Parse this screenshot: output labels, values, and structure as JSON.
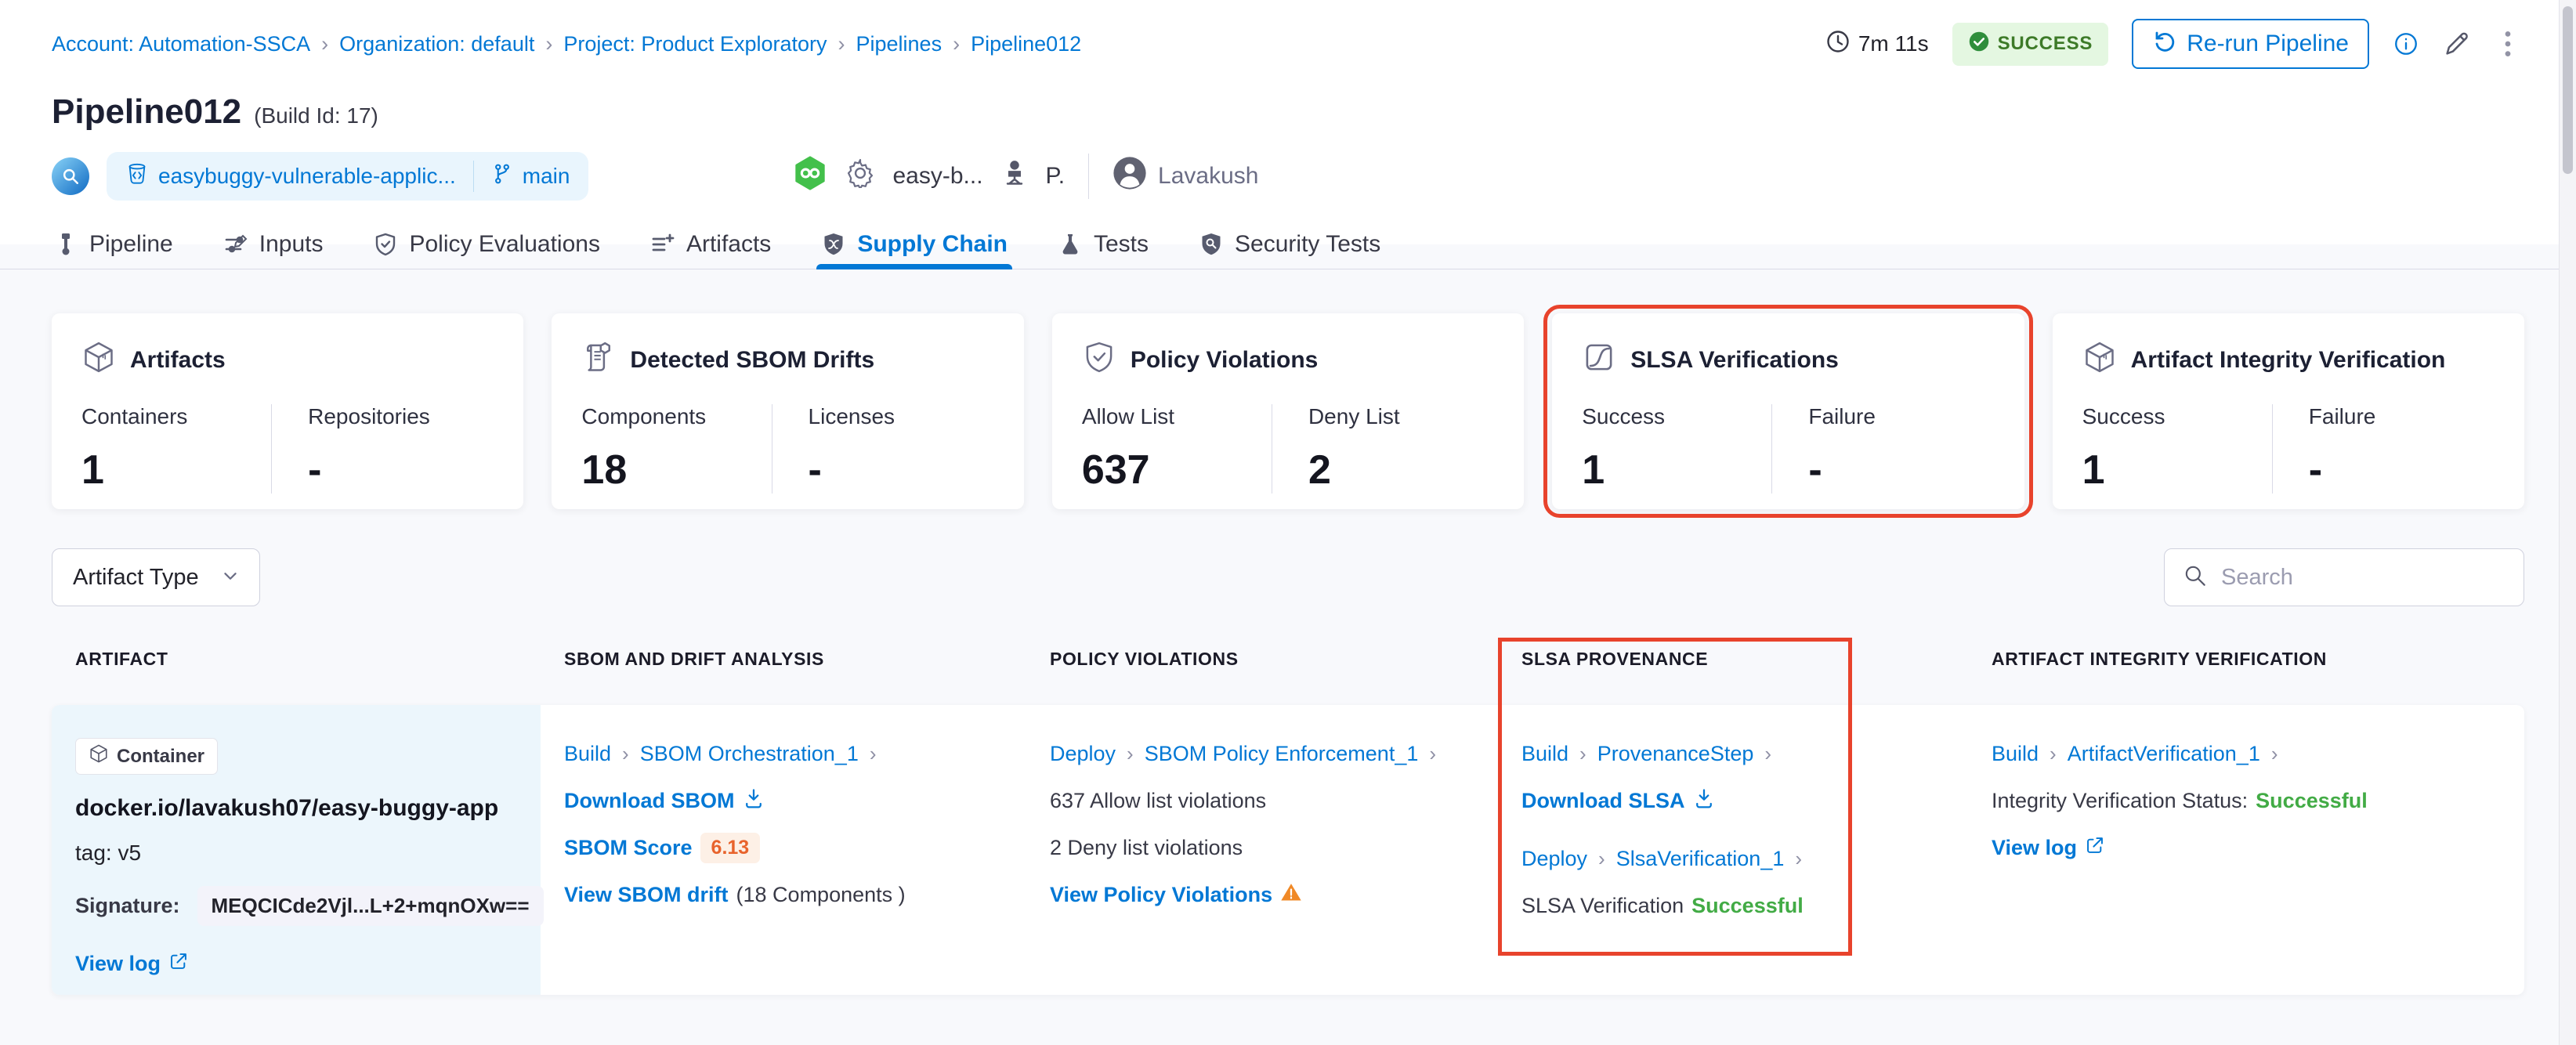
{
  "colors": {
    "accent_blue": "#0278d5",
    "success_green": "#42ab45",
    "highlight_red": "#e8432c",
    "warning_orange": "#ff832b",
    "score_orange": "#e8632c",
    "success_badge_bg": "#e4f7e1"
  },
  "icons": {
    "breadcrumb_separator": "›",
    "link_chevron": "›"
  },
  "breadcrumb": {
    "items": [
      "Account: Automation-SSCA",
      "Organization: default",
      "Project: Product Exploratory",
      "Pipelines",
      "Pipeline012"
    ]
  },
  "header": {
    "duration": "7m 11s",
    "status": "SUCCESS",
    "rerun_label": "Re-run Pipeline",
    "title": "Pipeline012",
    "build_id": "(Build Id: 17)",
    "repo": "easybuggy-vulnerable-applic...",
    "branch": "main",
    "trigger_name": "easy-b...",
    "trigger_suffix": "P.",
    "user": "Lavakush"
  },
  "tabs": [
    {
      "label": "Pipeline"
    },
    {
      "label": "Inputs"
    },
    {
      "label": "Policy Evaluations"
    },
    {
      "label": "Artifacts"
    },
    {
      "label": "Supply Chain"
    },
    {
      "label": "Tests"
    },
    {
      "label": "Security Tests"
    }
  ],
  "summary_cards": [
    {
      "title": "Artifacts",
      "stats": [
        {
          "label": "Containers",
          "value": "1"
        },
        {
          "label": "Repositories",
          "value": "-"
        }
      ]
    },
    {
      "title": "Detected SBOM Drifts",
      "stats": [
        {
          "label": "Components",
          "value": "18"
        },
        {
          "label": "Licenses",
          "value": "-"
        }
      ]
    },
    {
      "title": "Policy Violations",
      "stats": [
        {
          "label": "Allow List",
          "value": "637"
        },
        {
          "label": "Deny List",
          "value": "2"
        }
      ]
    },
    {
      "title": "SLSA Verifications",
      "stats": [
        {
          "label": "Success",
          "value": "1"
        },
        {
          "label": "Failure",
          "value": "-"
        }
      ]
    },
    {
      "title": "Artifact Integrity Verification",
      "stats": [
        {
          "label": "Success",
          "value": "1"
        },
        {
          "label": "Failure",
          "value": "-"
        }
      ]
    }
  ],
  "filters": {
    "artifact_type_label": "Artifact Type",
    "search_placeholder": "Search"
  },
  "table": {
    "columns": [
      "ARTIFACT",
      "SBOM AND DRIFT ANALYSIS",
      "POLICY VIOLATIONS",
      "SLSA PROVENANCE",
      "ARTIFACT INTEGRITY VERIFICATION"
    ],
    "row": {
      "artifact": {
        "type_badge": "Container",
        "image": "docker.io/lavakush07/easy-buggy-app",
        "tag": "tag: v5",
        "signature_label": "Signature:",
        "signature_value": "MEQCICde2Vjl...L+2+mqnOXw==",
        "view_log": "View log"
      },
      "sbom": {
        "stage": "Build",
        "step": "SBOM Orchestration_1",
        "download_label": "Download SBOM",
        "score_label": "SBOM Score",
        "score_value": "6.13",
        "drift_link": "View SBOM drift",
        "drift_suffix": "(18 Components )"
      },
      "policy": {
        "stage": "Deploy",
        "step": "SBOM Policy Enforcement_1",
        "allow_text": "637 Allow list violations",
        "deny_text": "2 Deny list violations",
        "view_link": "View Policy Violations"
      },
      "slsa": {
        "stage1": "Build",
        "step1": "ProvenanceStep",
        "download_label": "Download SLSA",
        "stage2": "Deploy",
        "step2": "SlsaVerification_1",
        "status_label": "SLSA Verification",
        "status_value": "Successful"
      },
      "integrity": {
        "stage": "Build",
        "step": "ArtifactVerification_1",
        "status_label": "Integrity Verification Status:",
        "status_value": "Successful",
        "view_log": "View log"
      }
    }
  }
}
